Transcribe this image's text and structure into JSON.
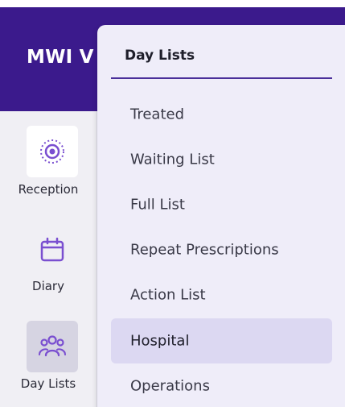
{
  "header": {
    "brand_text": "MWI V"
  },
  "sidebar": {
    "items": [
      {
        "label": "Reception",
        "icon": "reception-dot-icon"
      },
      {
        "label": "Diary",
        "icon": "calendar-icon"
      },
      {
        "label": "Day Lists",
        "icon": "users-group-icon",
        "active": true
      }
    ]
  },
  "dropdown": {
    "title": "Day Lists",
    "items": [
      {
        "label": "Treated"
      },
      {
        "label": "Waiting List"
      },
      {
        "label": "Full List"
      },
      {
        "label": "Repeat Prescriptions"
      },
      {
        "label": "Action List"
      },
      {
        "label": "Hospital",
        "active": true
      },
      {
        "label": "Operations"
      }
    ]
  },
  "colors": {
    "topbar": "#3b1a8c",
    "accent": "#7a4fd0",
    "menu_bg": "#efedf9",
    "menu_active": "#dcd8f2",
    "sidebar_bg": "#f0eff4"
  }
}
